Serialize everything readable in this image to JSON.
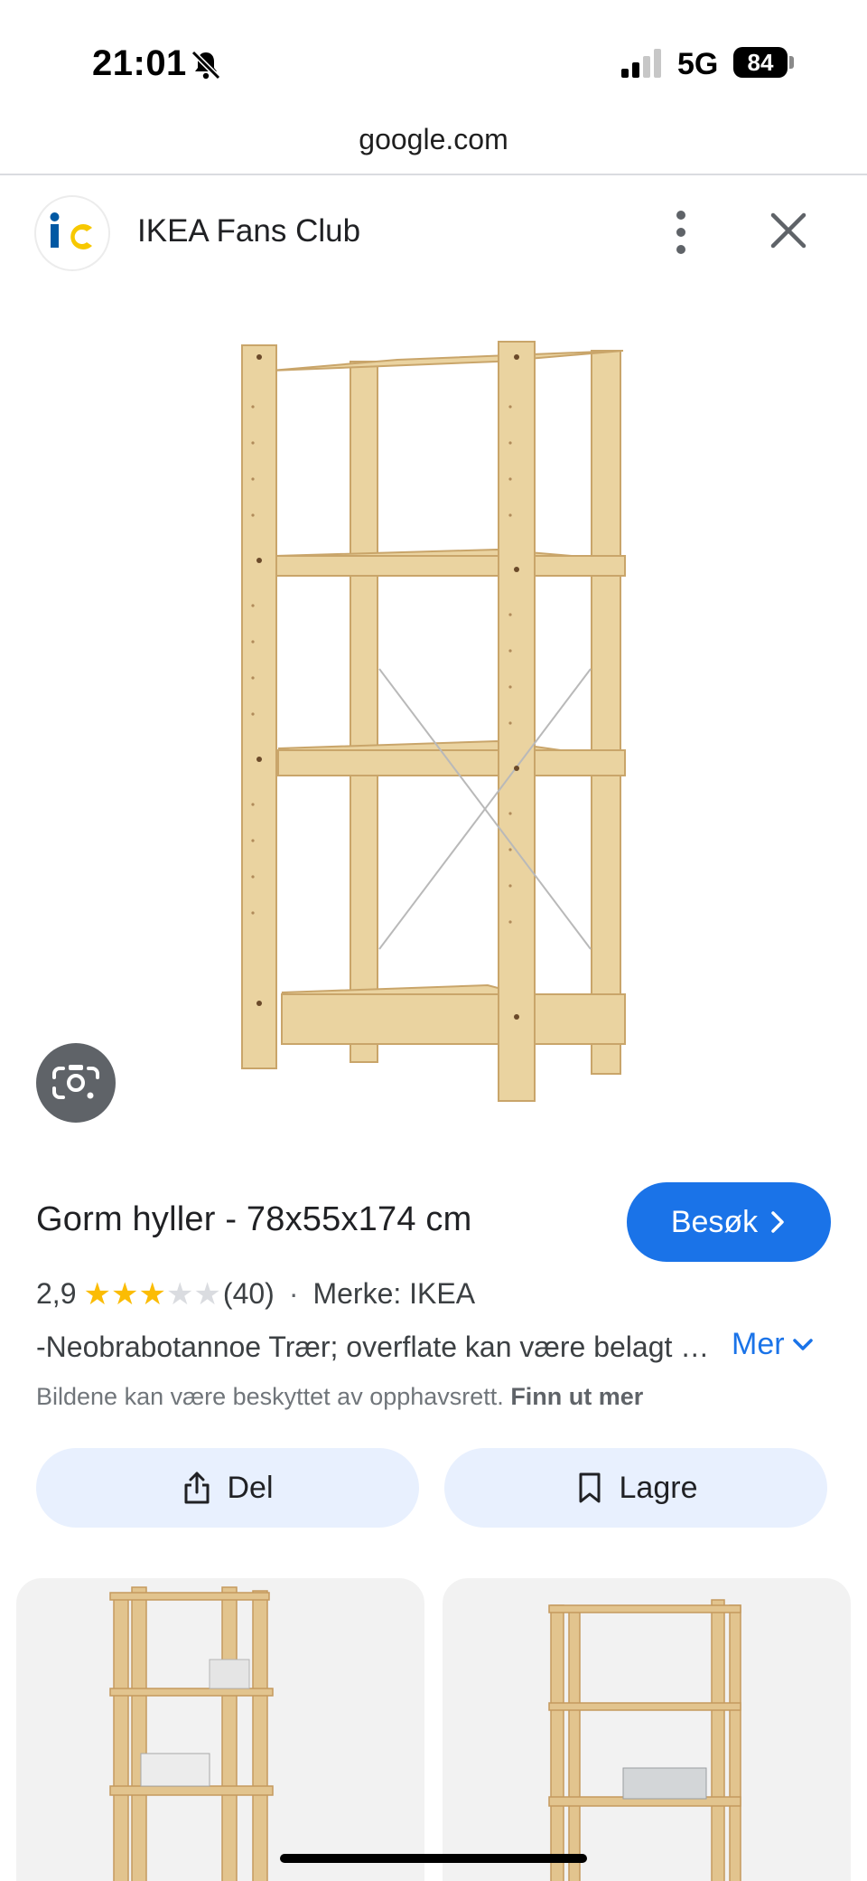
{
  "status_bar": {
    "time": "21:01",
    "network": "5G",
    "battery": "84"
  },
  "url_bar": {
    "domain": "google.com"
  },
  "source": {
    "name": "IKEA Fans Club"
  },
  "product": {
    "title": "Gorm hyller - 78x55x174 cm",
    "visit_label": "Besøk",
    "rating_value": "2,9",
    "rating_stars": 3,
    "rating_max": 5,
    "rating_count": "(40)",
    "separator": "·",
    "brand": "Merke: IKEA",
    "description": "-Neobrabotannoe Trær; overflate kan være belagt med trebeis",
    "more_label": "Mer",
    "copyright_text": "Bildene kan være beskyttet av opphavsrett.",
    "copyright_link": "Finn ut mer"
  },
  "actions": {
    "share_label": "Del",
    "save_label": "Lagre"
  },
  "colors": {
    "accent": "#1a73e8",
    "star": "#fbbc04",
    "button_bg": "#e8f0fe",
    "wood": "#e8cf9a"
  }
}
